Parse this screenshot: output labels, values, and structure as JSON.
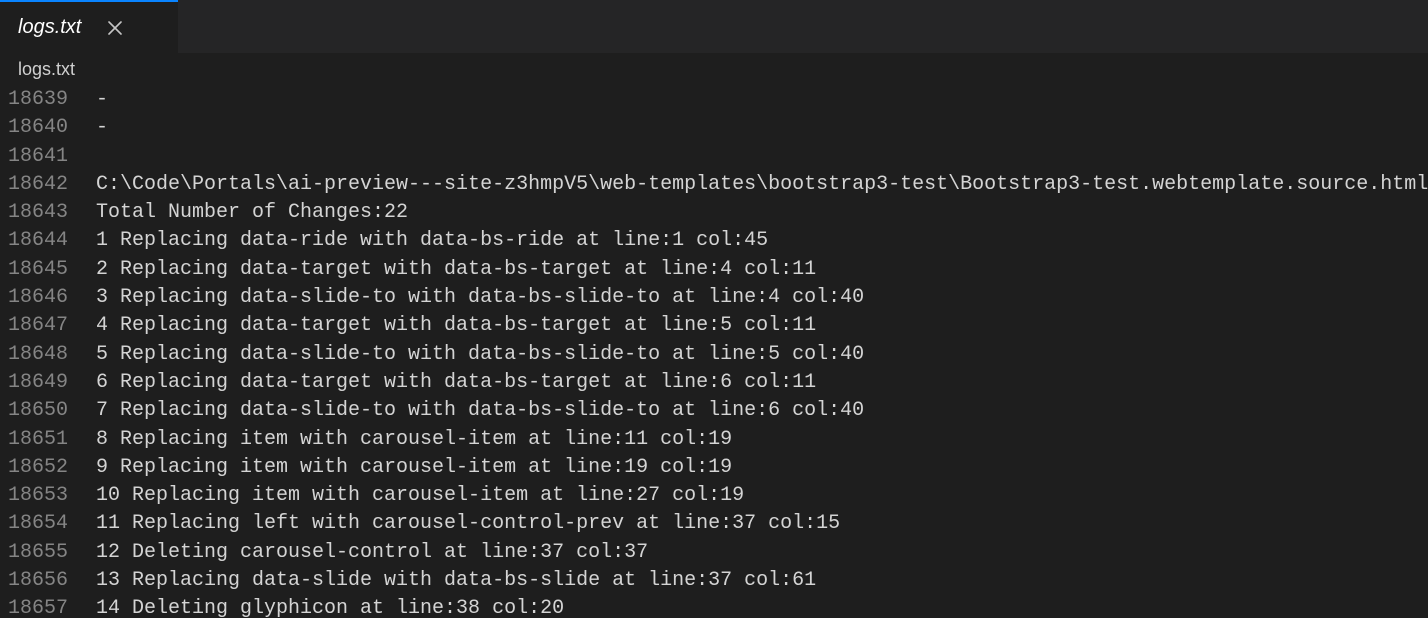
{
  "tab": {
    "label": "logs.txt",
    "close_aria": "Close"
  },
  "breadcrumb": {
    "filename": "logs.txt"
  },
  "lines": [
    {
      "num": "18639",
      "text": "-"
    },
    {
      "num": "18640",
      "text": "-"
    },
    {
      "num": "18641",
      "text": ""
    },
    {
      "num": "18642",
      "text": "C:\\Code\\Portals\\ai-preview---site-z3hmpV5\\web-templates\\bootstrap3-test\\Bootstrap3-test.webtemplate.source.html"
    },
    {
      "num": "18643",
      "text": "Total Number of Changes:22"
    },
    {
      "num": "18644",
      "text": "1 Replacing data-ride with data-bs-ride at line:1 col:45"
    },
    {
      "num": "18645",
      "text": "2 Replacing data-target with data-bs-target at line:4 col:11"
    },
    {
      "num": "18646",
      "text": "3 Replacing data-slide-to with data-bs-slide-to at line:4 col:40"
    },
    {
      "num": "18647",
      "text": "4 Replacing data-target with data-bs-target at line:5 col:11"
    },
    {
      "num": "18648",
      "text": "5 Replacing data-slide-to with data-bs-slide-to at line:5 col:40"
    },
    {
      "num": "18649",
      "text": "6 Replacing data-target with data-bs-target at line:6 col:11"
    },
    {
      "num": "18650",
      "text": "7 Replacing data-slide-to with data-bs-slide-to at line:6 col:40"
    },
    {
      "num": "18651",
      "text": "8 Replacing item with carousel-item at line:11 col:19"
    },
    {
      "num": "18652",
      "text": "9 Replacing item with carousel-item at line:19 col:19"
    },
    {
      "num": "18653",
      "text": "10 Replacing item with carousel-item at line:27 col:19"
    },
    {
      "num": "18654",
      "text": "11 Replacing left with carousel-control-prev at line:37 col:15"
    },
    {
      "num": "18655",
      "text": "12 Deleting carousel-control at line:37 col:37"
    },
    {
      "num": "18656",
      "text": "13 Replacing data-slide with data-bs-slide at line:37 col:61"
    },
    {
      "num": "18657",
      "text": "14 Deleting glyphicon at line:38 col:20"
    }
  ]
}
